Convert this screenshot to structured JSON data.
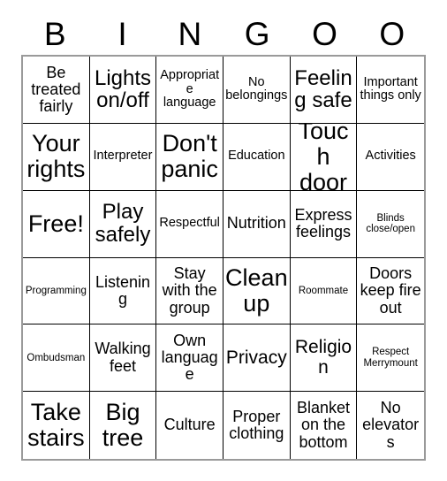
{
  "header": {
    "letters": [
      "B",
      "I",
      "N",
      "G",
      "O",
      "O"
    ]
  },
  "grid": {
    "columns": 6,
    "rows": 6,
    "cells": [
      {
        "text": "Be treated fairly",
        "size": "fs-m"
      },
      {
        "text": "Lights on/off",
        "size": "fs-xl"
      },
      {
        "text": "Appropriate language",
        "size": "fs-s"
      },
      {
        "text": "No belongings",
        "size": "fs-s"
      },
      {
        "text": "Feeling safe",
        "size": "fs-xl"
      },
      {
        "text": "Important things only",
        "size": "fs-s"
      },
      {
        "text": "Your rights",
        "size": "fs-xxl"
      },
      {
        "text": "Interpreter",
        "size": "fs-s"
      },
      {
        "text": "Don't panic",
        "size": "fs-xxl"
      },
      {
        "text": "Education",
        "size": "fs-s"
      },
      {
        "text": "Touch door",
        "size": "fs-xxl"
      },
      {
        "text": "Activities",
        "size": "fs-s"
      },
      {
        "text": "Free!",
        "size": "fs-xxl"
      },
      {
        "text": "Play safely",
        "size": "fs-xl"
      },
      {
        "text": "Respectful",
        "size": "fs-s"
      },
      {
        "text": "Nutrition",
        "size": "fs-m"
      },
      {
        "text": "Express feelings",
        "size": "fs-m"
      },
      {
        "text": "Blinds close/open",
        "size": "fs-xs"
      },
      {
        "text": "Programming",
        "size": "fs-xs"
      },
      {
        "text": "Listening",
        "size": "fs-m"
      },
      {
        "text": "Stay with the group",
        "size": "fs-m"
      },
      {
        "text": "Clean up",
        "size": "fs-xxl"
      },
      {
        "text": "Roommate",
        "size": "fs-xs"
      },
      {
        "text": "Doors keep fire out",
        "size": "fs-m"
      },
      {
        "text": "Ombudsman",
        "size": "fs-xs"
      },
      {
        "text": "Walking feet",
        "size": "fs-m"
      },
      {
        "text": "Own language",
        "size": "fs-m"
      },
      {
        "text": "Privacy",
        "size": "fs-l"
      },
      {
        "text": "Religion",
        "size": "fs-l"
      },
      {
        "text": "Respect Merrymount",
        "size": "fs-xs"
      },
      {
        "text": "Take stairs",
        "size": "fs-xxl"
      },
      {
        "text": "Big tree",
        "size": "fs-xxl"
      },
      {
        "text": "Culture",
        "size": "fs-m"
      },
      {
        "text": "Proper clothing",
        "size": "fs-m"
      },
      {
        "text": "Blanket on the bottom",
        "size": "fs-m"
      },
      {
        "text": "No elevators",
        "size": "fs-m"
      }
    ]
  },
  "colors": {
    "background": "#ffffff",
    "text": "#000000",
    "inner_border": "#000000",
    "outer_border": "#9a9a9a"
  }
}
